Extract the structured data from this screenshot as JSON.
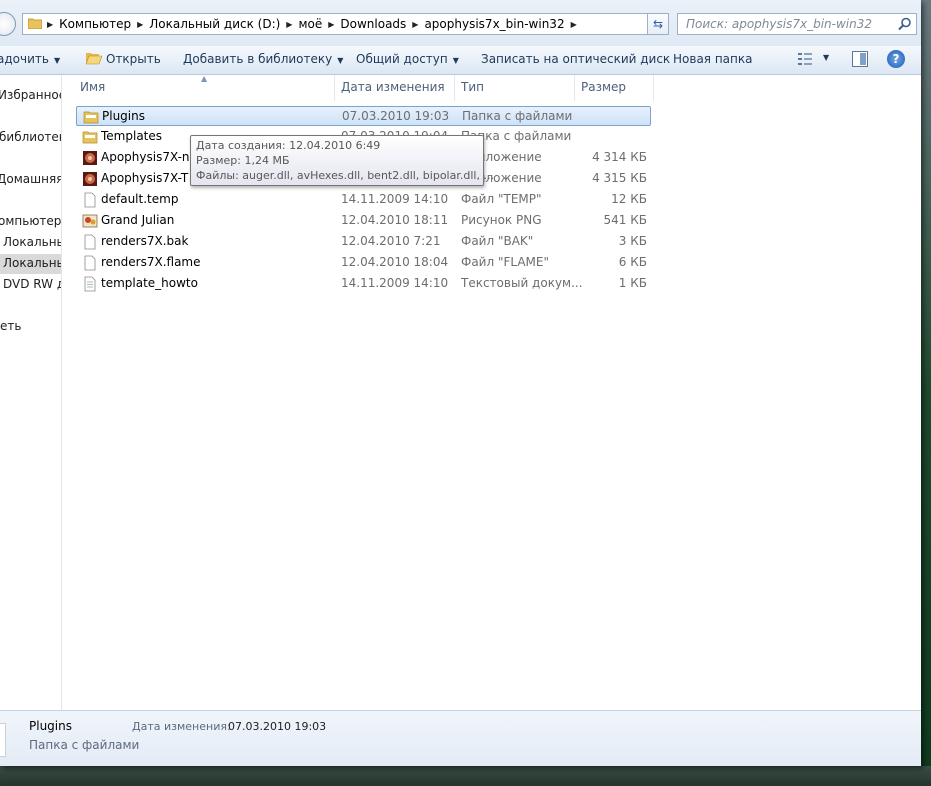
{
  "address": {
    "crumbs": [
      "Компьютер",
      "Локальный диск (D:)",
      "моё",
      "Downloads",
      "apophysis7x_bin-win32"
    ],
    "search_placeholder": "Поиск: apophysis7x_bin-win32"
  },
  "toolbar": {
    "organize": "адочить",
    "open": "Открыть",
    "add_library": "Добавить в библиотеку",
    "share": "Общий доступ",
    "burn": "Записать на оптический диск",
    "new_folder": "Новая папка"
  },
  "nav": {
    "items": [
      "Избранное",
      "библиотеки",
      "Домашняя г",
      "омпьютер",
      "Локальны",
      "Локальны",
      "DVD RW ди",
      "еть"
    ]
  },
  "columns": {
    "name": "Имя",
    "date": "Дата изменения",
    "type": "Тип",
    "size": "Размер"
  },
  "files": [
    {
      "name": "Plugins",
      "date": "07.03.2010 19:03",
      "type": "Папка с файлами",
      "size": "",
      "icon": "folder-icon"
    },
    {
      "name": "Templates",
      "date": "07.03.2010 19:04",
      "type": "Папка с файлами",
      "size": "",
      "icon": "folder-icon"
    },
    {
      "name": "Apophysis7X-nor",
      "date": "",
      "type": "Приложение",
      "size": "4 314 КБ",
      "icon": "app-icon"
    },
    {
      "name": "Apophysis7X-T50",
      "date": "",
      "type": "Приложение",
      "size": "4 315 КБ",
      "icon": "app-icon"
    },
    {
      "name": "default.temp",
      "date": "14.11.2009 14:10",
      "type": "Файл \"TEMP\"",
      "size": "12 КБ",
      "icon": "file-icon"
    },
    {
      "name": "Grand Julian",
      "date": "12.04.2010 18:11",
      "type": "Рисунок PNG",
      "size": "541 КБ",
      "icon": "image-icon"
    },
    {
      "name": "renders7X.bak",
      "date": "12.04.2010 7:21",
      "type": "Файл \"BAK\"",
      "size": "3 КБ",
      "icon": "file-icon"
    },
    {
      "name": "renders7X.flame",
      "date": "12.04.2010 18:04",
      "type": "Файл \"FLAME\"",
      "size": "6 КБ",
      "icon": "file-icon"
    },
    {
      "name": "template_howto",
      "date": "14.11.2009 14:10",
      "type": "Текстовый докум...",
      "size": "1 КБ",
      "icon": "text-file-icon"
    }
  ],
  "tooltip": {
    "created": "Дата создания: 12.04.2010 6:49",
    "size": "Размер: 1,24 МБ",
    "files": "Файлы: auger.dll, avHexes.dll, bent2.dll, bipolar.dll, ..."
  },
  "details": {
    "name": "Plugins",
    "type": "Папка с файлами",
    "modified_label": "Дата изменения:",
    "modified_value": "07.03.2010 19:03"
  }
}
